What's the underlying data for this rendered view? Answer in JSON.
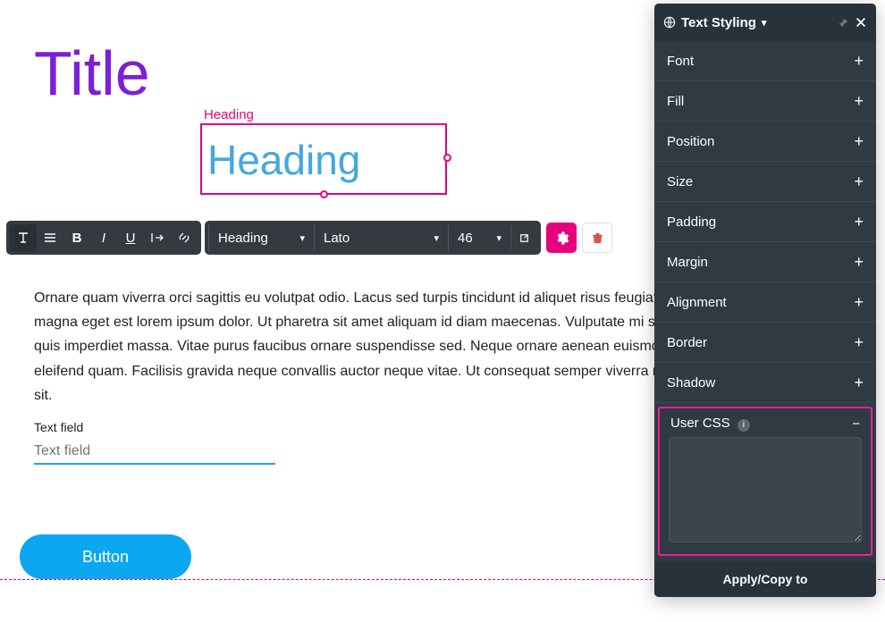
{
  "canvas": {
    "title": "Title",
    "heading_label": "Heading",
    "heading_text": "Heading",
    "body_text": "Ornare quam viverra orci sagittis eu volutpat odio. Lacus sed turpis tincidunt id aliquet risus feugiat odio eu feugiat. Dolor magna eget est lorem ipsum dolor. Ut pharetra sit amet aliquam id diam maecenas. Vulputate mi sit amet mauris commodo quis imperdiet massa. Vitae purus faucibus ornare suspendisse sed. Neque ornare aenean euismod elementum nisi quis eleifend quam. Facilisis gravida neque convallis auctor neque vitae. Ut consequat semper viverra nam libero justo laoreet sit.",
    "text_field_label": "Text field",
    "text_field_placeholder": "Text field",
    "button_label": "Button"
  },
  "toolbar": {
    "style": "Heading",
    "font": "Lato",
    "size": "46"
  },
  "panel": {
    "title": "Text Styling",
    "sections": [
      {
        "label": "Font"
      },
      {
        "label": "Fill"
      },
      {
        "label": "Position"
      },
      {
        "label": "Size"
      },
      {
        "label": "Padding"
      },
      {
        "label": "Margin"
      },
      {
        "label": "Alignment"
      },
      {
        "label": "Border"
      },
      {
        "label": "Shadow"
      }
    ],
    "user_css_label": "User CSS",
    "user_css_value": "",
    "footer": "Apply/Copy to"
  }
}
